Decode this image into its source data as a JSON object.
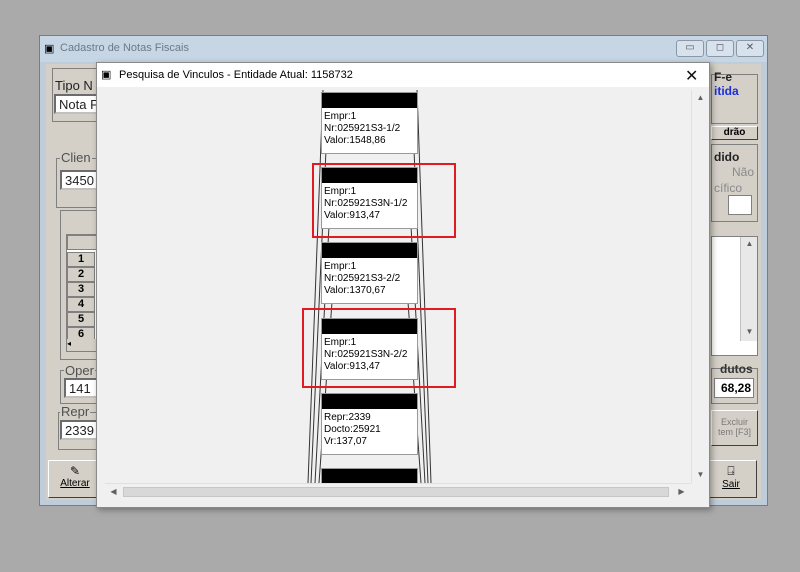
{
  "main_window": {
    "title": "Cadastro de Notas Fiscais",
    "fields": {
      "tipo_label": "Tipo N",
      "tipo_value": "Nota F",
      "cliente_label": "Clien",
      "cliente_value": "3450",
      "oper_label": "Oper",
      "oper_value": "141",
      "repr_label": "Repr",
      "repr_value": "2339"
    },
    "rows": [
      "1",
      "2",
      "3",
      "4",
      "5",
      "6"
    ],
    "right_panel": {
      "nfe_title": "F-e",
      "status": "itida",
      "padrao": "drão",
      "pedido_label": "dido",
      "nao_label": "Não",
      "especifico_label": "cífico",
      "produtos_label": "dutos",
      "produtos_value": "68,28",
      "excluir_label": "Excluir",
      "item_label": "tem [F3]"
    },
    "buttons": {
      "alterar": "Alterar",
      "sair": "Sair"
    }
  },
  "dialog": {
    "title": "Pesquisa de Vinculos - Entidade Atual: 1158732",
    "cards": [
      {
        "lines": [
          "Empr:1",
          "Nr:025921S3-1/2",
          "Valor:1548,86"
        ],
        "highlighted": false
      },
      {
        "lines": [
          "Empr:1",
          "Nr:025921S3N-1/2",
          "Valor:913,47"
        ],
        "highlighted": true
      },
      {
        "lines": [
          "Empr:1",
          "Nr:025921S3-2/2",
          "Valor:1370,67"
        ],
        "highlighted": false
      },
      {
        "lines": [
          "Empr:1",
          "Nr:025921S3N-2/2",
          "Valor:913,47"
        ],
        "highlighted": true
      },
      {
        "lines": [
          "Repr:2339",
          "Docto:25921",
          "Vr:137,07"
        ],
        "highlighted": false
      }
    ]
  },
  "colors": {
    "highlight": "#e01b24",
    "main_window_bg": "#d4d0c8",
    "desktop": "#aaaaaa"
  }
}
